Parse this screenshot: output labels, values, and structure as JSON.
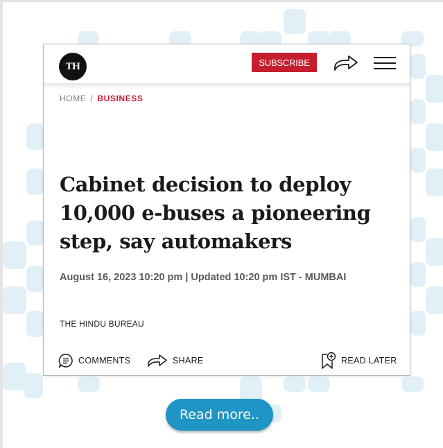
{
  "header": {
    "logo_text": "TH",
    "subscribe_label": "SUBSCRIBE",
    "share_icon": "share-arrow-icon",
    "menu_icon": "hamburger-menu-icon"
  },
  "breadcrumb": {
    "home": "HOME",
    "separator": "/",
    "current": "BUSINESS"
  },
  "article": {
    "headline": "Cabinet decision to deploy 10,000 e-buses a pioneering step, say automakers",
    "dateline": "August 16, 2023 10:20 pm | Updated 10:20 pm IST - MUMBAI",
    "author": "THE HINDU BUREAU"
  },
  "actions": {
    "comments_label": "COMMENTS",
    "share_label": "SHARE",
    "read_later_label": "READ LATER"
  },
  "read_more_label": "Read more..",
  "colors": {
    "accent_red": "#c51e2f",
    "button_blue": "#1e95c4",
    "pattern_blue": "#e1f0f6"
  }
}
